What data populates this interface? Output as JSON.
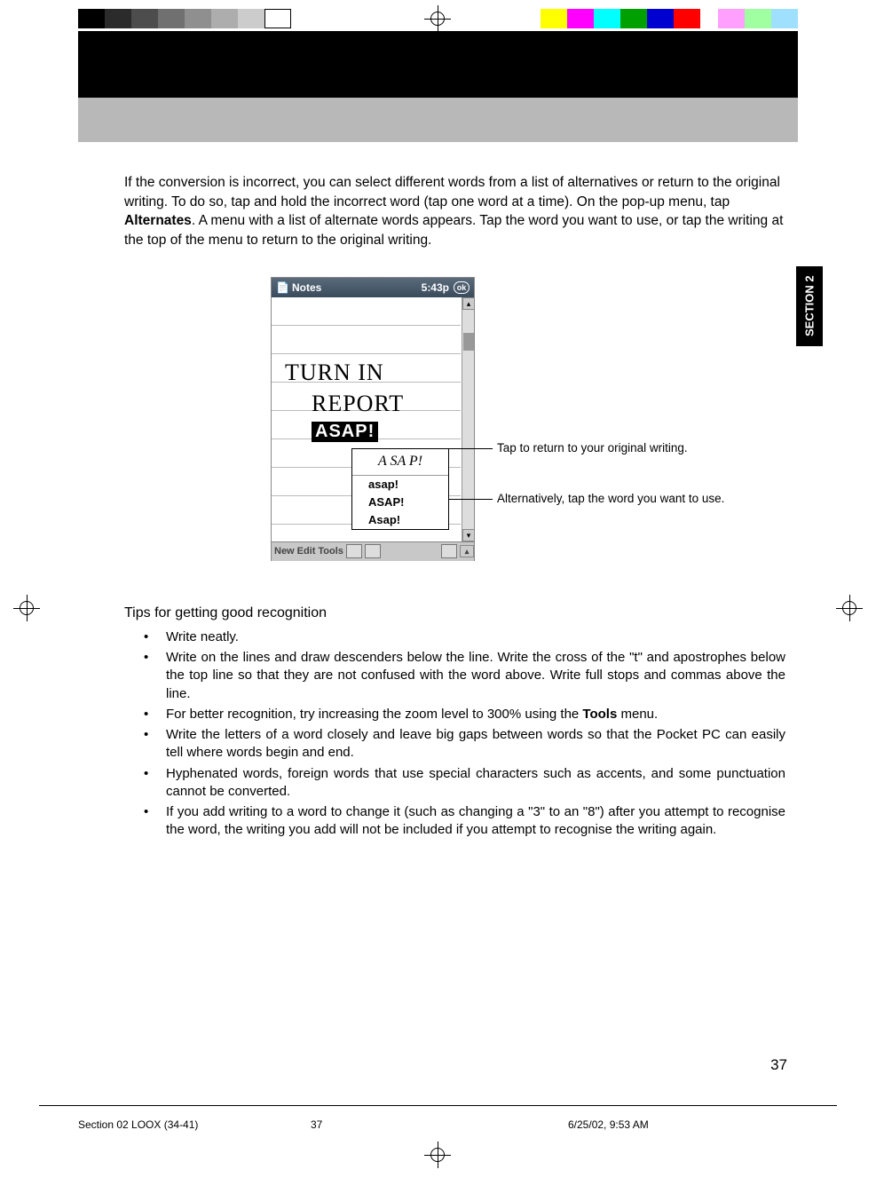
{
  "colorbar": [
    "#000",
    "#2b2b2b",
    "#4d4d4d",
    "#707070",
    "#8f8f8f",
    "#adadad",
    "#cccccc",
    "#fff",
    "",
    "#ffff00",
    "#ff00ff",
    "#00ffff",
    "#00a000",
    "#0000d0",
    "#ff0000",
    "",
    "#ffa0ff",
    "#a0ffa0",
    "#a0e0ff"
  ],
  "section_tab": "SECTION 2",
  "para1_a": "If the conversion is incorrect, you can select different words from a list of alternatives or return to the original writing. To do so, tap and hold the incorrect word (tap one word at a time). On the pop-up menu, tap ",
  "para1_bold": "Alternates",
  "para1_b": ". A menu with a list of alternate words appears. Tap the word you want to use, or tap the writing at the top of the menu to return to the original writing.",
  "device": {
    "title": "Notes",
    "time": "5:43p",
    "ok": "ok",
    "hw_line1": "TURN IN",
    "hw_line2": "REPORT",
    "hw_selected": "ASAP!",
    "popup_hw": "A SA P!",
    "popup_items": [
      "asap!",
      "ASAP!",
      "Asap!"
    ],
    "footer": [
      "New",
      "Edit",
      "Tools"
    ]
  },
  "callout1": "Tap to return to your original writing.",
  "callout2": "Alternatively, tap the word you want to use.",
  "tips_heading": "Tips for getting good recognition",
  "tips": [
    {
      "text": "Write neatly."
    },
    {
      "text": "Write on the lines and draw descenders below the line. Write the cross of the \"t\" and apostrophes below the top line so that they are not confused with the word above. Write full stops and commas above the line."
    },
    {
      "text_a": "For better recognition, try increasing the zoom level to 300% using the ",
      "bold": "Tools",
      "text_b": " menu."
    },
    {
      "text": "Write the letters of a word closely and leave big gaps between words so that the Pocket PC can easily tell where words begin and end."
    },
    {
      "text": "Hyphenated words, foreign words that use special characters such as accents, and some punctuation cannot be converted."
    },
    {
      "text": "If you add writing to a word to change it (such as changing a \"3\" to an \"8\") after you attempt to recognise the word, the writing you add will not be included if you attempt to recognise the writing again."
    }
  ],
  "page_number": "37",
  "footer_left": "Section 02 LOOX (34-41)",
  "footer_center": "37",
  "footer_right": "6/25/02, 9:53 AM"
}
